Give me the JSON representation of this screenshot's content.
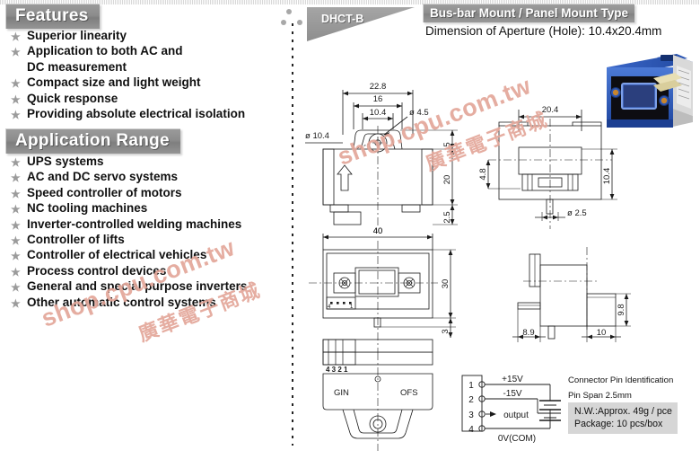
{
  "features": {
    "heading": "Features",
    "items": [
      {
        "text": "Superior linearity",
        "cont": null
      },
      {
        "text": "Application to both AC and",
        "cont": "DC measurement"
      },
      {
        "text": "Compact size and light weight",
        "cont": null
      },
      {
        "text": "Quick response",
        "cont": null
      },
      {
        "text": "Providing absolute electrical isolation",
        "cont": null
      }
    ]
  },
  "application_range": {
    "heading": "Application Range",
    "items": [
      "UPS systems",
      "AC and DC servo systems",
      "Speed controller of motors",
      "NC tooling machines",
      "Inverter-controlled welding machines",
      "Controller of lifts",
      "Controller of electrical vehicles",
      "Process control devices",
      "General and special purpose inverters",
      "Other automatic control systems"
    ]
  },
  "header": {
    "model": "DHCT-B",
    "title": "Bus-bar Mount / Panel Mount Type",
    "subtitle": "Dimension of Aperture (Hole): 10.4x20.4mm"
  },
  "drawings": {
    "front": {
      "dims": {
        "overall_width": "22.8",
        "inner_width": "16",
        "slot_width": "10.4",
        "hole_dia": "ø 4.5",
        "aperture_dia": "ø 10.4",
        "top_height": "5",
        "body_height": "20",
        "pin_height": "2.5",
        "base_width": "40"
      }
    },
    "top_view": {
      "dims": {
        "width": "40",
        "height": "30",
        "tail": "3"
      },
      "connector_pins": "4  3  2  1"
    },
    "bottom_view": {
      "pin_labels": "4 3 2 1",
      "left_label": "GIN",
      "right_label": "OFS"
    },
    "side_right": {
      "dims": {
        "aperture_width": "20.4",
        "offset": "4.8",
        "aperture_height": "10.4",
        "pin_dia": "ø 2.5"
      }
    },
    "side_lower": {
      "dims": {
        "left": "8.9",
        "right": "10",
        "height": "9.8"
      }
    }
  },
  "wiring": {
    "pins": [
      {
        "number": "1",
        "label": "+15V"
      },
      {
        "number": "2",
        "label": "-15V"
      },
      {
        "number": "3",
        "label": "output"
      },
      {
        "number": "4",
        "label": "0V(COM)"
      }
    ]
  },
  "notes": {
    "connector_title": "Connector  Pin  Identification",
    "pin_span": "Pin Span 2.5mm",
    "net_weight": "N.W.:Approx. 49g / pce",
    "package": "Package: 10 pcs/box"
  },
  "watermarks": {
    "english": "shop.cpu.com.tw",
    "chinese": "廣華電子商城"
  },
  "colors": {
    "banner_gray": "#8d8d8d",
    "product_blue": "#2f5fc4",
    "watermark": "#e3a79a",
    "line": "#1a1a1a"
  }
}
